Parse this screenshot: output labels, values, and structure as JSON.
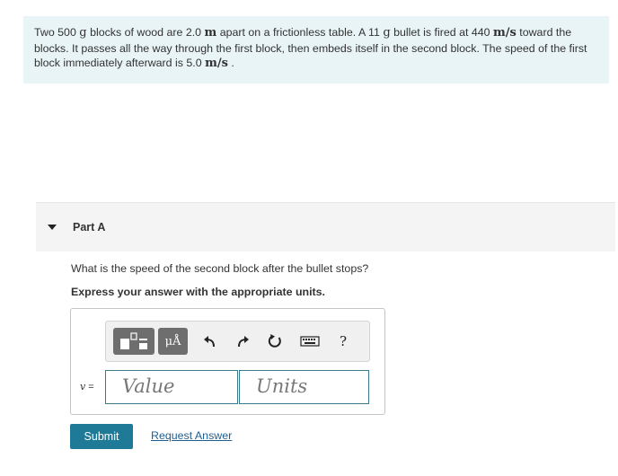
{
  "problem": {
    "t1": "Two 500 ",
    "m1": "g",
    "t2": " blocks of wood are 2.0 ",
    "m2": "m",
    "t3": " apart on a frictionless table. A 11 ",
    "m3": "g",
    "t4": " bullet is fired at 440 ",
    "m4": "m/s",
    "t5": " toward the blocks. It passes all the way through the first block, then embeds itself in the second block. The speed of the first block immediately afterward is 5.0 ",
    "m5": "m/s",
    "t6": " ."
  },
  "part": {
    "title": "Part A",
    "question": "What is the speed of the second block after the bullet stops?",
    "instruction": "Express your answer with the appropriate units."
  },
  "toolbar": {
    "units_label": "μÅ",
    "help_label": "?",
    "icons": [
      "templates-icon",
      "units-icon",
      "undo-icon",
      "redo-icon",
      "reset-icon",
      "keyboard-icon",
      "help-icon"
    ]
  },
  "answer": {
    "variable": "v",
    "equals": "=",
    "value_placeholder": "Value",
    "units_placeholder": "Units"
  },
  "actions": {
    "submit_label": "Submit",
    "request_label": "Request Answer"
  },
  "colors": {
    "problem_bg": "#e8f4f6",
    "submit_bg": "#1f7a98",
    "link": "#1f5f92"
  }
}
